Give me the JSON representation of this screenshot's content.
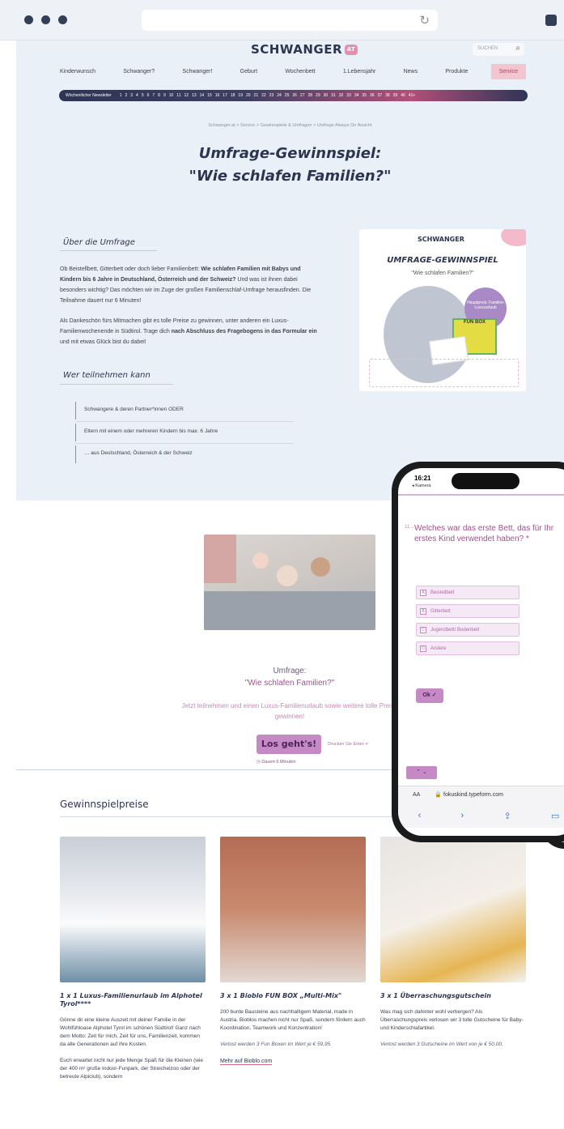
{
  "browser": {
    "reload_icon": "reload-icon"
  },
  "header": {
    "logo": "SCHWANGER",
    "logo_badge": "AT",
    "search_placeholder": "SUCHEN",
    "nav": [
      "Kinderwunsch",
      "Schwanger?",
      "Schwanger!",
      "Geburt",
      "Wochenbett",
      "1.Lebensjahr",
      "News",
      "Produkte",
      "Service"
    ],
    "weeks_label": "Wöchentlicher Newsletter",
    "weeks": [
      "1",
      "2",
      "3",
      "4",
      "5",
      "6",
      "7",
      "8",
      "9",
      "10",
      "11",
      "12",
      "13",
      "14",
      "15",
      "16",
      "17",
      "18",
      "19",
      "20",
      "21",
      "22",
      "23",
      "24",
      "25",
      "26",
      "27",
      "28",
      "29",
      "30",
      "31",
      "32",
      "33",
      "34",
      "35",
      "36",
      "37",
      "38",
      "39",
      "40",
      "41+"
    ]
  },
  "breadcrumb": "Schwanger.at  >  Service  >  Gewinnspiele & Umfragen  >  Umfrage Always On Ansicht",
  "title": {
    "line1": "Umfrage-Gewinnspiel:",
    "line2": "\"Wie schlafen Familien?\""
  },
  "about": {
    "heading": "Über die Umfrage",
    "p1_a": "Ob Beistellbett, Gitterbett oder doch lieber Familienbett: ",
    "p1_b": "Wie schlafen Familien mit Babys und Kindern bis 6 Jahre in Deutschland, Österreich und der Schweiz?",
    "p1_c": " Und was ist ihnen dabei besonders wichtig? Das möchten wir im Zuge der großen Familienschlaf-Umfrage herausfinden. Die Teilnahme dauert nur 6 Minuten!",
    "p2_a": "Als Dankeschön fürs Mitmachen gibt es tolle Preise zu gewinnen, unter anderen ein Luxus-Familienwochenende in Südtirol. Trage dich ",
    "p2_b": "nach Abschluss des Fragebogens in das Formular ein",
    "p2_c": " und mit etwas Glück bist du dabei!"
  },
  "promo": {
    "logo": "SCHWANGER",
    "title": "UMFRAGE-GEWINNSPIEL",
    "subtitle": "\"Wie schlafen Familien?\"",
    "badge": "Hauptpreis: Familien Luxusurlaub",
    "box": "FUN BOX"
  },
  "who": {
    "heading": "Wer teilnehmen kann",
    "items": [
      "Schwangere & deren Partner*innen ODER",
      "Eltern mit einem oder mehreren Kindern bis max. 6 Jahre",
      "… aus Deutschland, Österreich & der Schweiz"
    ]
  },
  "survey": {
    "label": "Umfrage:",
    "title": "\"Wie schlafen Familien?\"",
    "desc": "Jetzt teilnehmen und einen Luxus-Familienurlaub sowie weitere tolle Preise gewinnen!",
    "button": "Los geht's!",
    "enter_hint": "Drücken Sie Enter ↵",
    "duration": "Dauert 6 Minuten"
  },
  "prizes": {
    "heading": "Gewinnspielpreise",
    "items": [
      {
        "title": "1 x 1 Luxus-Familienurlaub im Alphotel Tyrol****",
        "text": "Gönne dir eine kleine Auszeit mit deiner Familie in der Wohlfühloase Alphotel Tyrol im schönen Südtirol! Ganz nach dem Motto: Zeit für mich, Zeit für uns, Familienzeit, kommen da alle Generationen auf ihre Kosten.",
        "text2": "Euch erwartet nicht nur jede Menge Spaß für die Kleinen (wie der 400 m² große Indoor-Funpark, der Streichelzoo oder der betreute Alpiclub), sondern"
      },
      {
        "title": "3 x 1 Bioblo FUN BOX „Multi-Mix\"",
        "text": "200 bunte Bausteine aus nachhaltigem Material, made in Austria. Bioblos machen nicht nur Spaß, sondern fördern auch Koordination, Teamwork und Konzentration!",
        "note": "Verlost werden 3 Fun Boxen im Wert je € 59,95.",
        "link": "Mehr auf Bioblo.com"
      },
      {
        "title": "3 x 1 Überraschungsgutschein",
        "text": "Was mag sich dahinter wohl verbergen? Als Überraschungspreis verlosen wir 3 tolle Gutscheine für Baby- und Kinderschlafartikel.",
        "note": "Verlost werden 3 Gutscheine im Wert von je € 50,00."
      }
    ]
  },
  "phone": {
    "time": "16:21",
    "back": "◂ Kamera",
    "qnum": "11→",
    "question": "Welches war das erste Bett, das für Ihr erstes Kind verwendet haben? *",
    "options": [
      {
        "key": "A",
        "label": "Beistellbett"
      },
      {
        "key": "B",
        "label": "Gitterbett"
      },
      {
        "key": "C",
        "label": "Jugendbett/ Bodenbett"
      },
      {
        "key": "D",
        "label": "Andere"
      }
    ],
    "ok": "Ok ✓",
    "updown": "⌃  ⌄",
    "aa": "AA",
    "url": "🔒 fokuskind.typeform.com"
  }
}
